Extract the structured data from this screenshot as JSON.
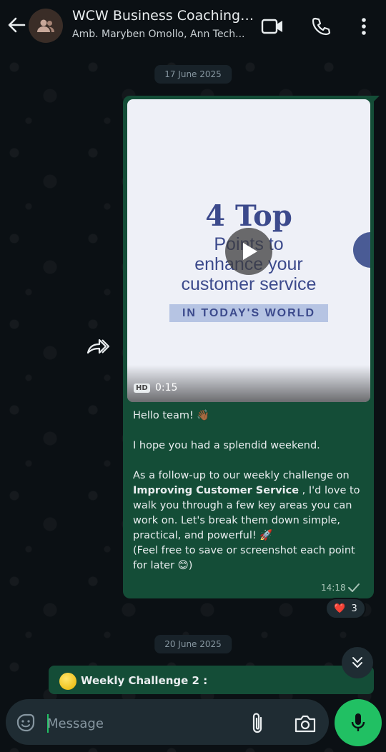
{
  "header": {
    "title": "WCW Business Coaching C...",
    "subtitle": "Amb. Maryben Omollo, Ann Tech..."
  },
  "messages": {
    "date_1": "17 June 2025",
    "date_2": "20 June 2025",
    "video": {
      "heading": "4 Top",
      "line1": "Points to",
      "line2": "enhance your",
      "line3": "customer service",
      "band": "IN TODAY'S WORLD",
      "hd": "HD",
      "duration": "0:15"
    },
    "text": {
      "greeting": "Hello team! 👋🏾",
      "hope": "I hope you had a splendid weekend.",
      "para_start": "As a follow-up to our weekly challenge on",
      "para_bold": "Improving Customer Service",
      "para_rest": " , I'd love to walk you through a few key areas you can work on. Let's break them down  simple, practical, and powerful! 🚀",
      "para_end": "(Feel free to save or screenshot each point for later 😊)"
    },
    "time": "14:18",
    "reaction_emoji": "❤️",
    "reaction_count": "3",
    "next_message": "Weekly Challenge 2 :"
  },
  "composer": {
    "placeholder": "Message"
  },
  "colors": {
    "bubble": "#144d37",
    "accent": "#21c063",
    "background": "#0b1014"
  },
  "icons": {
    "back": "back-arrow-icon",
    "video_call": "video-camera-icon",
    "call": "phone-icon",
    "menu": "more-vertical-icon",
    "forward": "forward-icon",
    "play": "play-icon",
    "emoji": "sticker-icon",
    "attach": "paperclip-icon",
    "camera": "camera-icon",
    "mic": "mic-icon",
    "scroll_down": "double-chevron-down-icon"
  }
}
